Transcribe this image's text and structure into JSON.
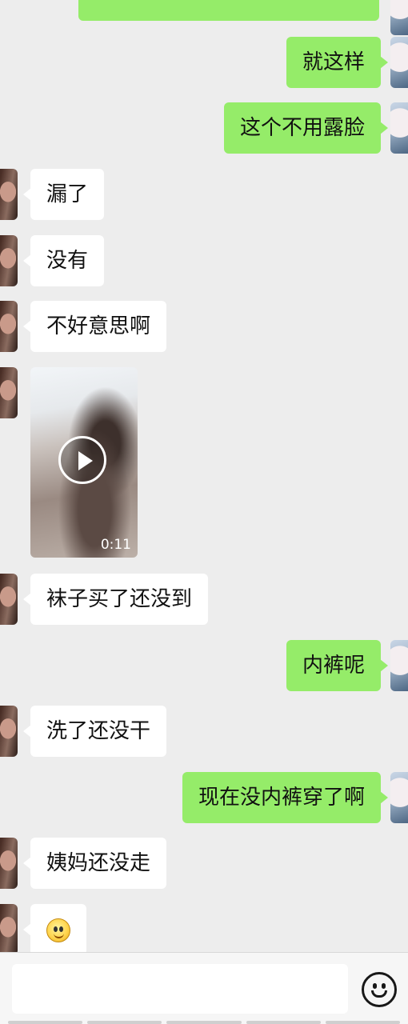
{
  "messages": [
    {
      "side": "out",
      "text": "就这样"
    },
    {
      "side": "out",
      "text": "这个不用露脸"
    },
    {
      "side": "in",
      "text": "漏了"
    },
    {
      "side": "in",
      "text": "没有"
    },
    {
      "side": "in",
      "text": "不好意思啊"
    },
    {
      "side": "in",
      "type": "video",
      "duration": "0:11"
    },
    {
      "side": "in",
      "text": "袜子买了还没到"
    },
    {
      "side": "out",
      "text": "内裤呢"
    },
    {
      "side": "in",
      "text": "洗了还没干"
    },
    {
      "side": "out",
      "text": "现在没内裤穿了啊"
    },
    {
      "side": "in",
      "text": "姨妈还没走"
    },
    {
      "side": "in",
      "type": "emoji",
      "emoji": "smile-emoji"
    }
  ],
  "input": {
    "value": "",
    "placeholder": ""
  },
  "icons": {
    "emoji_button": "emoji-face-icon"
  },
  "colors": {
    "background": "#ededed",
    "outgoing_bubble": "#95ec69",
    "incoming_bubble": "#ffffff"
  }
}
